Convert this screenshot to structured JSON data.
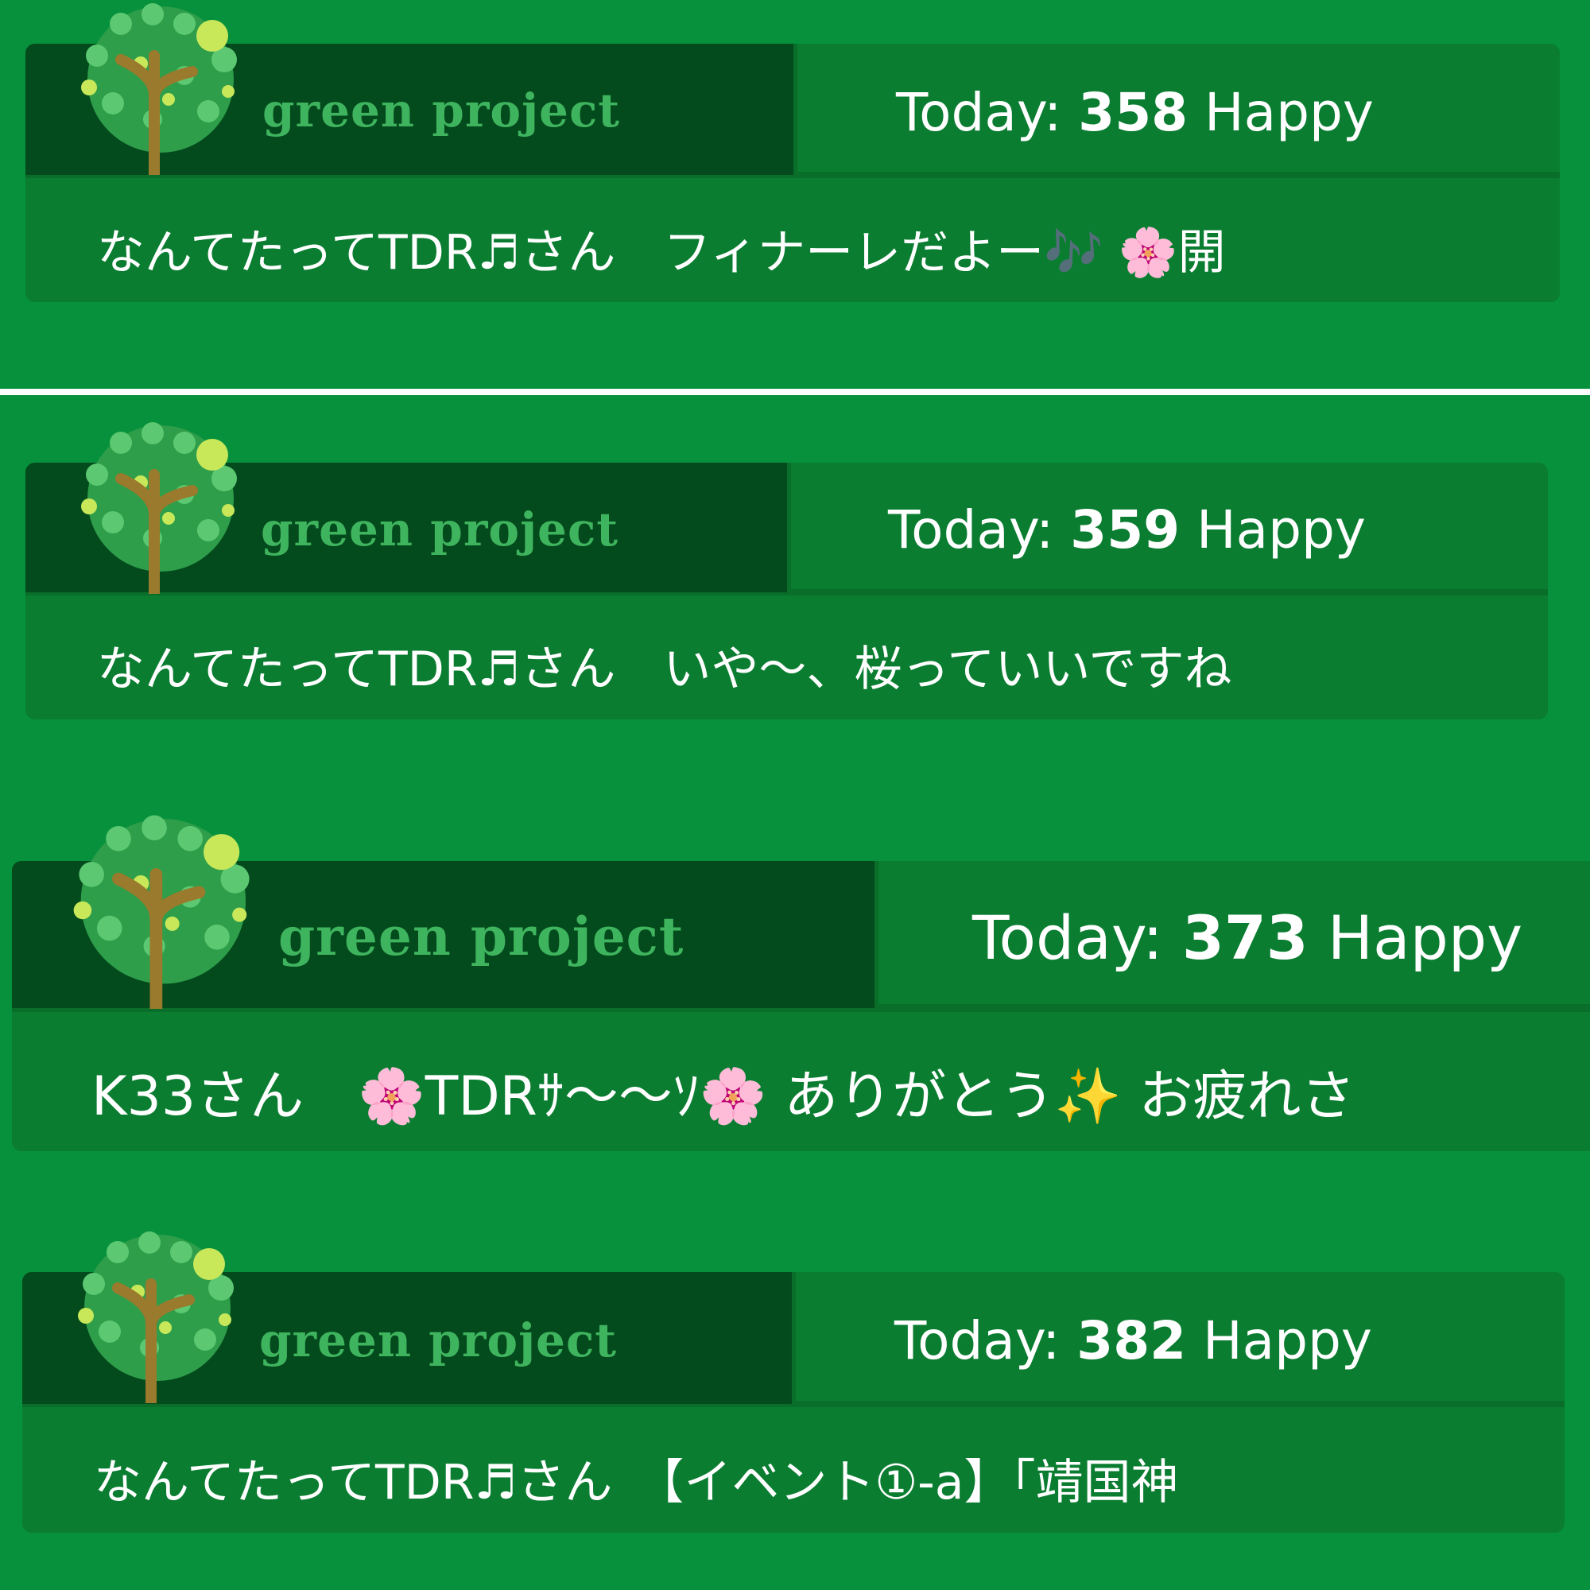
{
  "widgets": [
    {
      "brand": "green project",
      "counter": {
        "prefix": "Today: ",
        "count": "358",
        "suffix": " Happy"
      },
      "message": "なんてたってTDR♬さん　フィナーレだよー🎶 🌸開"
    },
    {
      "brand": "green project",
      "counter": {
        "prefix": "Today: ",
        "count": "359",
        "suffix": " Happy"
      },
      "message": "なんてたってTDR♬さん　いや〜、桜っていいですね"
    },
    {
      "brand": "green project",
      "counter": {
        "prefix": "Today: ",
        "count": "373",
        "suffix": " Happy"
      },
      "message": "K33さん　🌸TDRｻ〜〜ｿ🌸 ありがとう✨ お疲れさ"
    },
    {
      "brand": "green project",
      "counter": {
        "prefix": "Today: ",
        "count": "382",
        "suffix": " Happy"
      },
      "message": "なんてたってTDR♬さん　【イベント①-a】「靖国神"
    }
  ],
  "colors": {
    "background": "#08913c",
    "logo_panel": "#034a1c",
    "panel": "#0a7d31",
    "brand_text": "#3fb45e",
    "text": "#ffffff"
  },
  "icons": [
    "heart-tree-logo-icon"
  ]
}
